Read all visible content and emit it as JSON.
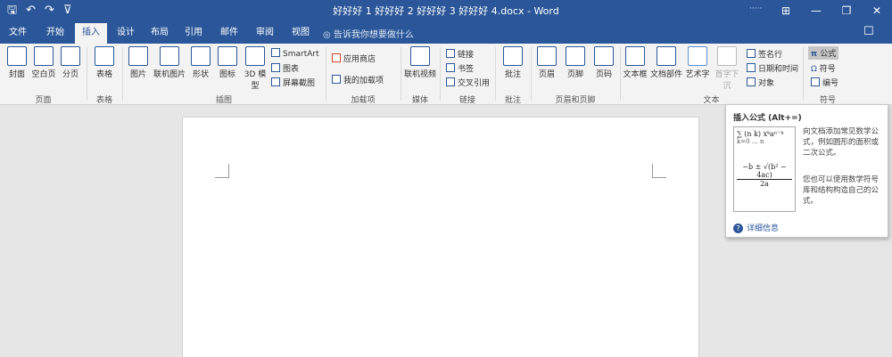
{
  "titlebar": {
    "qat": [
      "🖫",
      "↶",
      "↷",
      "⊽"
    ],
    "title": "好好好 1 好好好 2 好好好 3 好好好 4.docx - Word",
    "account": "·····",
    "window_controls": [
      "⊞",
      "—",
      "❐",
      "✕"
    ]
  },
  "tabs": [
    "文件",
    "开始",
    "插入",
    "设计",
    "布局",
    "引用",
    "邮件",
    "审阅",
    "视图"
  ],
  "active_tab": "插入",
  "tell_me": "告诉我你想要做什么",
  "ribbon": {
    "pages": {
      "cover": "封面",
      "blank": "空白页",
      "break": "分页",
      "label": "页面"
    },
    "tables": {
      "table": "表格",
      "label": "表格"
    },
    "illustrations": {
      "picture": "图片",
      "online_picture": "联机图片",
      "shapes": "形状",
      "icons": "图标",
      "model3d": "3D 模型",
      "smartart": "SmartArt",
      "chart": "图表",
      "screenshot": "屏幕截图",
      "label": "插图"
    },
    "addins": {
      "store": "应用商店",
      "my_addins": "我的加载项",
      "label": "加载项"
    },
    "media": {
      "online_video": "联机视频",
      "label": "媒体"
    },
    "links": {
      "link": "链接",
      "bookmark": "书签",
      "crossref": "交叉引用",
      "label": "链接"
    },
    "comments": {
      "comment": "批注",
      "label": "批注"
    },
    "header_footer": {
      "header": "页眉",
      "footer": "页脚",
      "page_number": "页码",
      "label": "页眉和页脚"
    },
    "text": {
      "textbox": "文本框",
      "quickparts": "文档部件",
      "wordart": "艺术字",
      "dropcap": "首字下沉",
      "signature": "签名行",
      "datetime": "日期和时间",
      "object": "对象",
      "label": "文本"
    },
    "symbols": {
      "equation": "公式",
      "symbol": "符号",
      "numbering": "编号",
      "label": "符号"
    }
  },
  "tooltip": {
    "title": "插入公式 (Alt+=)",
    "desc1": "向文档添加常见数学公式，例如圆形的面积或二次公式。",
    "desc2": "您也可以使用数学符号库和结构构造自己的公式。",
    "more": "详细信息",
    "formula1": "∑ (n k) xᵏaⁿ⁻ᵏ",
    "formula1_limits": "k=0 … n",
    "formula2": "−b ± √(b² − 4ac)",
    "formula2_den": "2a"
  },
  "colors": {
    "brand": "#2b579a",
    "ribbon_bg": "#f3f3f3",
    "doc_bg": "#e6e6e6"
  }
}
